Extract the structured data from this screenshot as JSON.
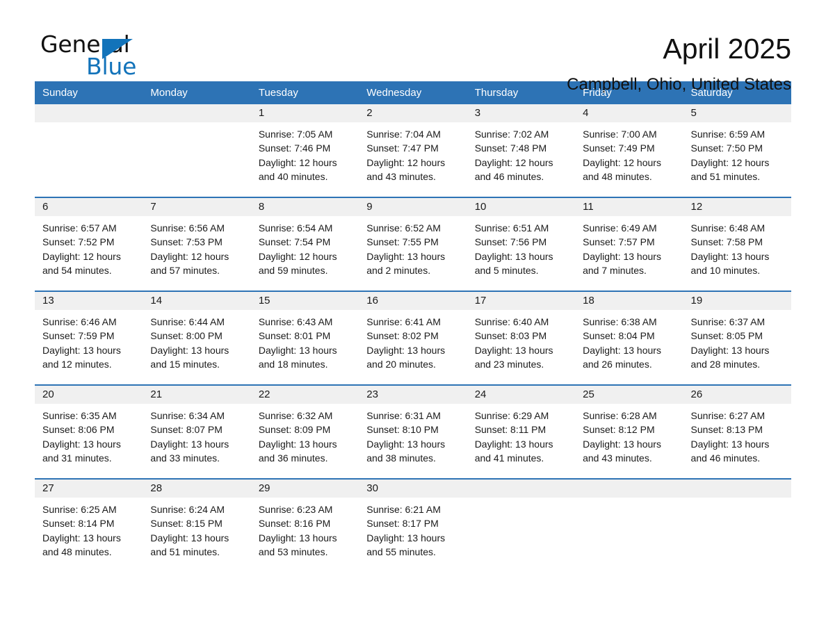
{
  "brand": {
    "word_one": "General",
    "word_two": "Blue",
    "triangle_color": "#1273BA"
  },
  "header": {
    "title": "April 2025",
    "subtitle": "Campbell, Ohio, United States"
  },
  "theme": {
    "header_blue": "#2D73B5",
    "daynum_band": "#F0F0F0",
    "text": "#1a1a1a"
  },
  "labels": {
    "sunrise_prefix": "Sunrise:",
    "sunset_prefix": "Sunset:",
    "daylight_prefix": "Daylight:"
  },
  "weekdays": [
    "Sunday",
    "Monday",
    "Tuesday",
    "Wednesday",
    "Thursday",
    "Friday",
    "Saturday"
  ],
  "weeks": [
    [
      {
        "day": ""
      },
      {
        "day": ""
      },
      {
        "day": "1",
        "sunrise": "Sunrise: 7:05 AM",
        "sunset": "Sunset: 7:46 PM",
        "daylight": "Daylight: 12 hours and 40 minutes."
      },
      {
        "day": "2",
        "sunrise": "Sunrise: 7:04 AM",
        "sunset": "Sunset: 7:47 PM",
        "daylight": "Daylight: 12 hours and 43 minutes."
      },
      {
        "day": "3",
        "sunrise": "Sunrise: 7:02 AM",
        "sunset": "Sunset: 7:48 PM",
        "daylight": "Daylight: 12 hours and 46 minutes."
      },
      {
        "day": "4",
        "sunrise": "Sunrise: 7:00 AM",
        "sunset": "Sunset: 7:49 PM",
        "daylight": "Daylight: 12 hours and 48 minutes."
      },
      {
        "day": "5",
        "sunrise": "Sunrise: 6:59 AM",
        "sunset": "Sunset: 7:50 PM",
        "daylight": "Daylight: 12 hours and 51 minutes."
      }
    ],
    [
      {
        "day": "6",
        "sunrise": "Sunrise: 6:57 AM",
        "sunset": "Sunset: 7:52 PM",
        "daylight": "Daylight: 12 hours and 54 minutes."
      },
      {
        "day": "7",
        "sunrise": "Sunrise: 6:56 AM",
        "sunset": "Sunset: 7:53 PM",
        "daylight": "Daylight: 12 hours and 57 minutes."
      },
      {
        "day": "8",
        "sunrise": "Sunrise: 6:54 AM",
        "sunset": "Sunset: 7:54 PM",
        "daylight": "Daylight: 12 hours and 59 minutes."
      },
      {
        "day": "9",
        "sunrise": "Sunrise: 6:52 AM",
        "sunset": "Sunset: 7:55 PM",
        "daylight": "Daylight: 13 hours and 2 minutes."
      },
      {
        "day": "10",
        "sunrise": "Sunrise: 6:51 AM",
        "sunset": "Sunset: 7:56 PM",
        "daylight": "Daylight: 13 hours and 5 minutes."
      },
      {
        "day": "11",
        "sunrise": "Sunrise: 6:49 AM",
        "sunset": "Sunset: 7:57 PM",
        "daylight": "Daylight: 13 hours and 7 minutes."
      },
      {
        "day": "12",
        "sunrise": "Sunrise: 6:48 AM",
        "sunset": "Sunset: 7:58 PM",
        "daylight": "Daylight: 13 hours and 10 minutes."
      }
    ],
    [
      {
        "day": "13",
        "sunrise": "Sunrise: 6:46 AM",
        "sunset": "Sunset: 7:59 PM",
        "daylight": "Daylight: 13 hours and 12 minutes."
      },
      {
        "day": "14",
        "sunrise": "Sunrise: 6:44 AM",
        "sunset": "Sunset: 8:00 PM",
        "daylight": "Daylight: 13 hours and 15 minutes."
      },
      {
        "day": "15",
        "sunrise": "Sunrise: 6:43 AM",
        "sunset": "Sunset: 8:01 PM",
        "daylight": "Daylight: 13 hours and 18 minutes."
      },
      {
        "day": "16",
        "sunrise": "Sunrise: 6:41 AM",
        "sunset": "Sunset: 8:02 PM",
        "daylight": "Daylight: 13 hours and 20 minutes."
      },
      {
        "day": "17",
        "sunrise": "Sunrise: 6:40 AM",
        "sunset": "Sunset: 8:03 PM",
        "daylight": "Daylight: 13 hours and 23 minutes."
      },
      {
        "day": "18",
        "sunrise": "Sunrise: 6:38 AM",
        "sunset": "Sunset: 8:04 PM",
        "daylight": "Daylight: 13 hours and 26 minutes."
      },
      {
        "day": "19",
        "sunrise": "Sunrise: 6:37 AM",
        "sunset": "Sunset: 8:05 PM",
        "daylight": "Daylight: 13 hours and 28 minutes."
      }
    ],
    [
      {
        "day": "20",
        "sunrise": "Sunrise: 6:35 AM",
        "sunset": "Sunset: 8:06 PM",
        "daylight": "Daylight: 13 hours and 31 minutes."
      },
      {
        "day": "21",
        "sunrise": "Sunrise: 6:34 AM",
        "sunset": "Sunset: 8:07 PM",
        "daylight": "Daylight: 13 hours and 33 minutes."
      },
      {
        "day": "22",
        "sunrise": "Sunrise: 6:32 AM",
        "sunset": "Sunset: 8:09 PM",
        "daylight": "Daylight: 13 hours and 36 minutes."
      },
      {
        "day": "23",
        "sunrise": "Sunrise: 6:31 AM",
        "sunset": "Sunset: 8:10 PM",
        "daylight": "Daylight: 13 hours and 38 minutes."
      },
      {
        "day": "24",
        "sunrise": "Sunrise: 6:29 AM",
        "sunset": "Sunset: 8:11 PM",
        "daylight": "Daylight: 13 hours and 41 minutes."
      },
      {
        "day": "25",
        "sunrise": "Sunrise: 6:28 AM",
        "sunset": "Sunset: 8:12 PM",
        "daylight": "Daylight: 13 hours and 43 minutes."
      },
      {
        "day": "26",
        "sunrise": "Sunrise: 6:27 AM",
        "sunset": "Sunset: 8:13 PM",
        "daylight": "Daylight: 13 hours and 46 minutes."
      }
    ],
    [
      {
        "day": "27",
        "sunrise": "Sunrise: 6:25 AM",
        "sunset": "Sunset: 8:14 PM",
        "daylight": "Daylight: 13 hours and 48 minutes."
      },
      {
        "day": "28",
        "sunrise": "Sunrise: 6:24 AM",
        "sunset": "Sunset: 8:15 PM",
        "daylight": "Daylight: 13 hours and 51 minutes."
      },
      {
        "day": "29",
        "sunrise": "Sunrise: 6:23 AM",
        "sunset": "Sunset: 8:16 PM",
        "daylight": "Daylight: 13 hours and 53 minutes."
      },
      {
        "day": "30",
        "sunrise": "Sunrise: 6:21 AM",
        "sunset": "Sunset: 8:17 PM",
        "daylight": "Daylight: 13 hours and 55 minutes."
      },
      {
        "day": ""
      },
      {
        "day": ""
      },
      {
        "day": ""
      }
    ]
  ]
}
